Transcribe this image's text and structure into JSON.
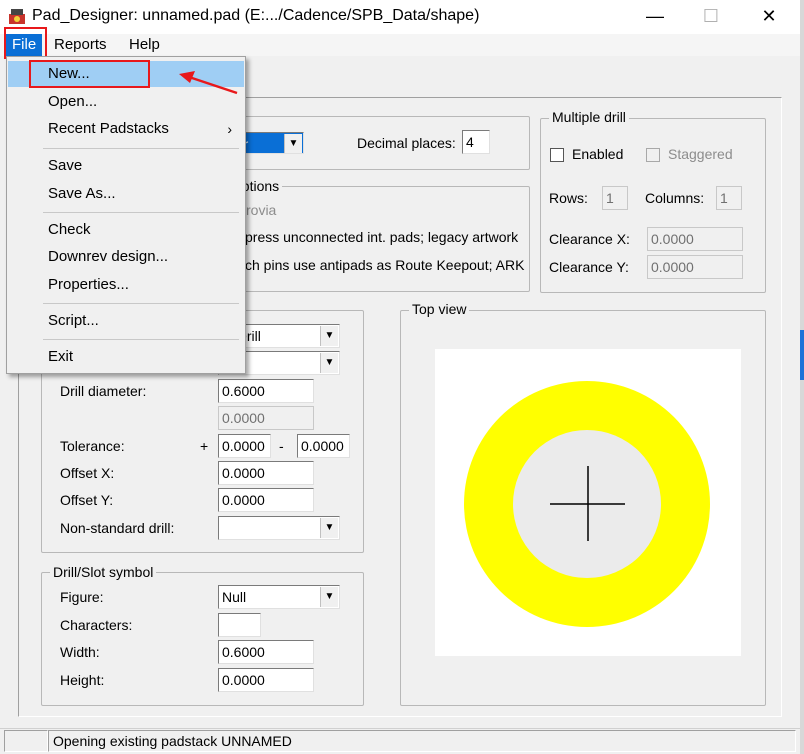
{
  "window": {
    "title": "Pad_Designer: unnamed.pad (E:.../Cadence/SPB_Data/shape)",
    "minimize": "—",
    "maximize": "☐",
    "close": "✕"
  },
  "menubar": {
    "items": [
      {
        "label": "File"
      },
      {
        "label": "Reports"
      },
      {
        "label": "Help"
      }
    ]
  },
  "file_menu": {
    "items": [
      {
        "label": "New..."
      },
      {
        "label": "Open..."
      },
      {
        "label": "Recent Padstacks",
        "arrow": "›"
      },
      {
        "label": "Save"
      },
      {
        "label": "Save As..."
      },
      {
        "label": "Check"
      },
      {
        "label": "Downrev design..."
      },
      {
        "label": "Properties..."
      },
      {
        "label": "Script..."
      },
      {
        "label": "Exit"
      }
    ]
  },
  "units": {
    "combo_partial": "ter",
    "decimal_label": "Decimal places:",
    "decimal_value": "4"
  },
  "options": {
    "title_partial": "options",
    "line1": "rovia",
    "line2": "press unconnected int. pads; legacy artwork",
    "line3": "ch pins use antipads as Route Keepout; ARK"
  },
  "multiple_drill": {
    "title": "Multiple drill",
    "enabled_label": "Enabled",
    "staggered_label": "Staggered",
    "rows_label": "Rows:",
    "rows_value": "1",
    "columns_label": "Columns:",
    "columns_value": "1",
    "clearance_x_label": "Clearance X:",
    "clearance_x_value": "0.0000",
    "clearance_y_label": "Clearance Y:",
    "clearance_y_value": "0.0000"
  },
  "drill": {
    "type_partial": "le Drill",
    "plating_partial": "ed",
    "diameter_label": "Drill diameter:",
    "diameter_value": "0.6000",
    "second_value": "0.0000",
    "tolerance_label": "Tolerance:",
    "plus": "+",
    "minus": "-",
    "tol_plus": "0.0000",
    "tol_minus": "0.0000",
    "offset_x_label": "Offset X:",
    "offset_x_value": "0.0000",
    "offset_y_label": "Offset Y:",
    "offset_y_value": "0.0000",
    "nonstandard_label": "Non-standard drill:",
    "nonstandard_value": ""
  },
  "symbol": {
    "title": "Drill/Slot symbol",
    "figure_label": "Figure:",
    "figure_value": "Null",
    "characters_label": "Characters:",
    "characters_value": "",
    "width_label": "Width:",
    "width_value": "0.6000",
    "height_label": "Height:",
    "height_value": "0.0000"
  },
  "top_view": {
    "title": "Top view",
    "pad_color": "#ffff00",
    "hole_color": "#ebebeb"
  },
  "status": {
    "text": "Opening existing padstack UNNAMED"
  },
  "icons": {
    "combo_arrow": "▼",
    "app": "pad-designer-icon"
  },
  "colors": {
    "highlight_red": "#e8181b",
    "menu_selected": "#0a6fd6"
  }
}
